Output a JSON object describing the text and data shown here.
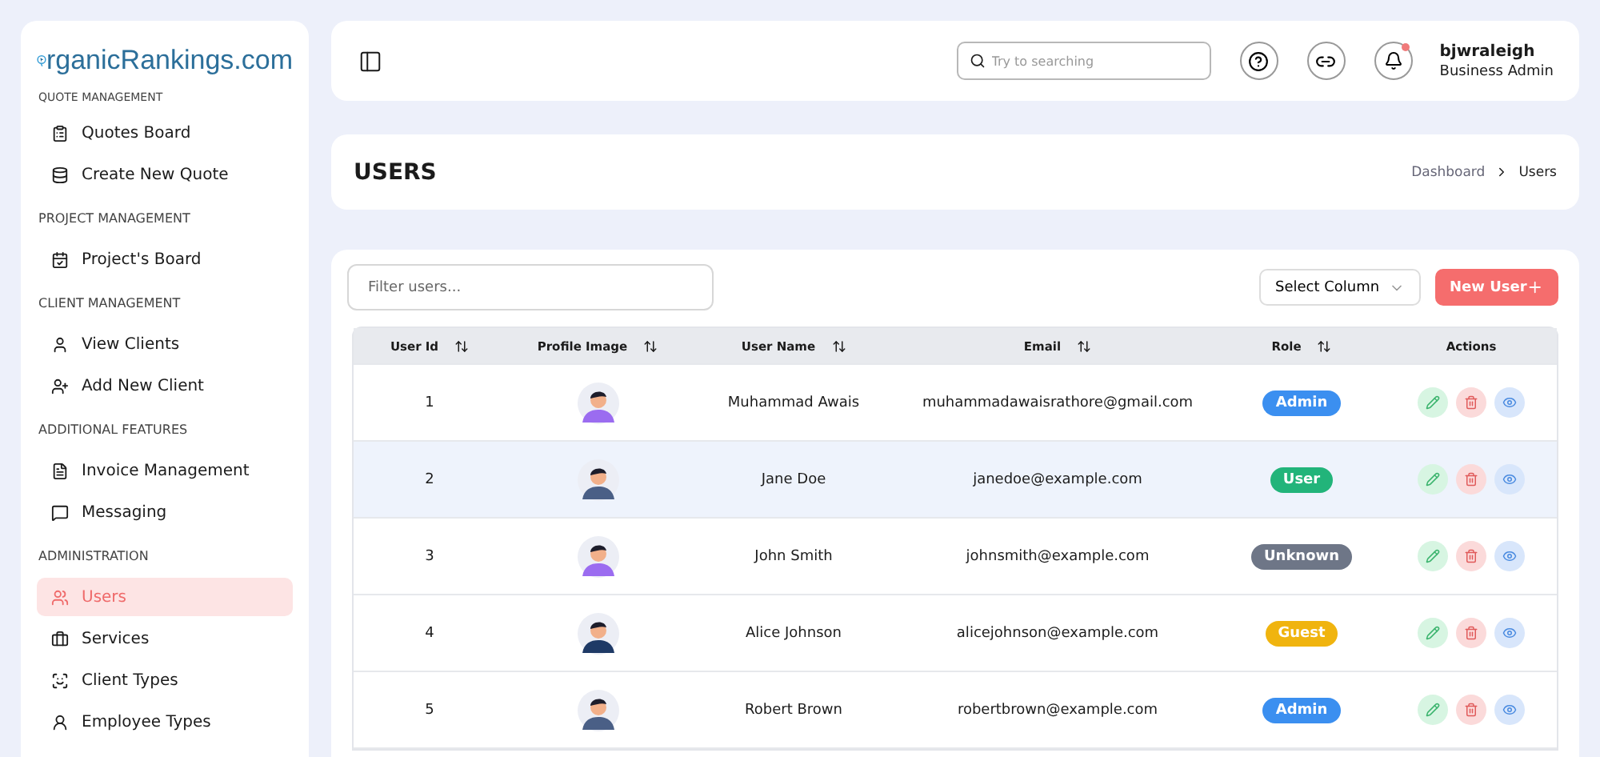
{
  "sidebar": {
    "logo": "rganicRankings.com",
    "sections": [
      {
        "heading": "QUOTE MANAGEMENT",
        "items": [
          {
            "label": "Quotes Board",
            "selected": false
          },
          {
            "label": "Create New Quote",
            "selected": false
          }
        ]
      },
      {
        "heading": "PROJECT MANAGEMENT",
        "items": [
          {
            "label": "Project's Board",
            "selected": false
          }
        ]
      },
      {
        "heading": "CLIENT MANAGEMENT",
        "items": [
          {
            "label": "View Clients",
            "selected": false
          },
          {
            "label": "Add New Client",
            "selected": false
          }
        ]
      },
      {
        "heading": "ADDITIONAL FEATURES",
        "items": [
          {
            "label": "Invoice Management",
            "selected": false
          },
          {
            "label": "Messaging",
            "selected": false
          }
        ]
      },
      {
        "heading": "ADMINISTRATION",
        "items": [
          {
            "label": "Users",
            "selected": true
          },
          {
            "label": "Services",
            "selected": false
          },
          {
            "label": "Client Types",
            "selected": false
          },
          {
            "label": "Employee Types",
            "selected": false
          }
        ]
      }
    ]
  },
  "header": {
    "search": {
      "placeholder": "Try to searching"
    },
    "notification": true,
    "user": {
      "name": "bjwraleigh",
      "role": "Business Admin"
    }
  },
  "page": {
    "title": "USERS",
    "breadcrumb": [
      "Dashboard",
      "Users"
    ]
  },
  "toolbar": {
    "filter": {
      "placeholder": "Filter users..."
    },
    "column_select": "Select Column",
    "new_button": "New User"
  },
  "table": {
    "columns": [
      "User Id",
      "Profile Image",
      "User Name",
      "Email",
      "Role",
      "Actions"
    ],
    "rows": [
      {
        "id": "1",
        "avatar": {
          "color": "#9b6cf0"
        },
        "name": "Muhammad Awais",
        "email": "muhammadawaisrathore@gmail.com",
        "role": {
          "label": "Admin",
          "color": "#3b8ff0"
        },
        "selected": false
      },
      {
        "id": "2",
        "avatar": {
          "color": "#4a5f86"
        },
        "name": "Jane Doe",
        "email": "janedoe@example.com",
        "role": {
          "label": "User",
          "color": "#22b47a"
        },
        "selected": true
      },
      {
        "id": "3",
        "avatar": {
          "color": "#9b6cf0"
        },
        "name": "John Smith",
        "email": "johnsmith@example.com",
        "role": {
          "label": "Unknown",
          "color": "#6e7687"
        },
        "selected": false
      },
      {
        "id": "4",
        "avatar": {
          "color": "#1f3a66"
        },
        "name": "Alice Johnson",
        "email": "alicejohnson@example.com",
        "role": {
          "label": "Guest",
          "color": "#f0b40f"
        },
        "selected": false
      },
      {
        "id": "5",
        "avatar": {
          "color": "#4a5f86"
        },
        "name": "Robert Brown",
        "email": "robertbrown@example.com",
        "role": {
          "label": "Admin",
          "color": "#3b8ff0"
        },
        "selected": false
      }
    ]
  }
}
